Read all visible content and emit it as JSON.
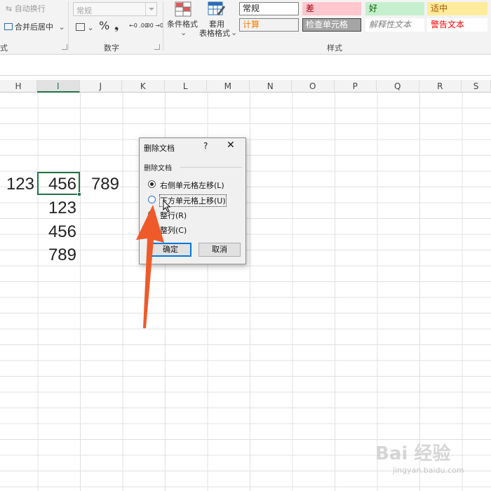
{
  "ribbon": {
    "wrap_text": "自动换行",
    "merge_center": "合并后居中",
    "merge_dropdown": "⌄",
    "alignment_label_fragment": "式",
    "number_format_value": "常规",
    "number_group_label": "数字",
    "currency_symbol": "%",
    "comma_symbol": "❟",
    "dec_increase": "←0 .00",
    "dec_decrease": ".00 →0",
    "conditional_format": "条件格式",
    "table_format_line1": "套用",
    "table_format_line2": "表格格式",
    "styles_group_label": "样式",
    "styles": [
      {
        "label": "常规",
        "bg": "#ffffff",
        "color": "#222222",
        "border": "#7f7f7f"
      },
      {
        "label": "差",
        "bg": "#ffc7ce",
        "color": "#9c0006",
        "border": "#ffc7ce"
      },
      {
        "label": "好",
        "bg": "#c6efce",
        "color": "#006100",
        "border": "#c6efce"
      },
      {
        "label": "适中",
        "bg": "#ffeb9c",
        "color": "#9c5700",
        "border": "#ffeb9c"
      },
      {
        "label": "计算",
        "bg": "#f2f2f2",
        "color": "#fa7d00",
        "border": "#7f7f7f"
      },
      {
        "label": "检查单元格",
        "bg": "#a5a5a5",
        "color": "#ffffff",
        "border": "#3f3f3f"
      },
      {
        "label": "解释性文本",
        "bg": "#ffffff",
        "color": "#7f7f7f",
        "border": "#ffffff"
      },
      {
        "label": "警告文本",
        "bg": "#ffffff",
        "color": "#ff0000",
        "border": "#ffffff"
      }
    ]
  },
  "columns": [
    "H",
    "I",
    "J",
    "K",
    "L",
    "M",
    "N",
    "O",
    "P",
    "Q",
    "R",
    "S"
  ],
  "selected_column": "I",
  "cells": {
    "h_row1": "123",
    "i_row1": "456",
    "j_row1": "789",
    "i_row2": "123",
    "i_row3": "456",
    "i_row4": "789"
  },
  "dialog": {
    "title": "删除文档",
    "help": "?",
    "close": "✕",
    "group_label": "删除文档",
    "options": [
      {
        "label": "右侧单元格左移(L)",
        "selected": true
      },
      {
        "label": "下方单元格上移(U)",
        "selected": false
      },
      {
        "label": "整行(R)",
        "selected": false
      },
      {
        "label": "整列(C)",
        "selected": false
      }
    ],
    "ok": "确定",
    "cancel": "取消"
  },
  "colors": {
    "excel_green": "#217346",
    "arrow": "#ee5a2a"
  },
  "watermark": {
    "brand": "Bai 经验",
    "url": "jingyan.baidu.com"
  }
}
